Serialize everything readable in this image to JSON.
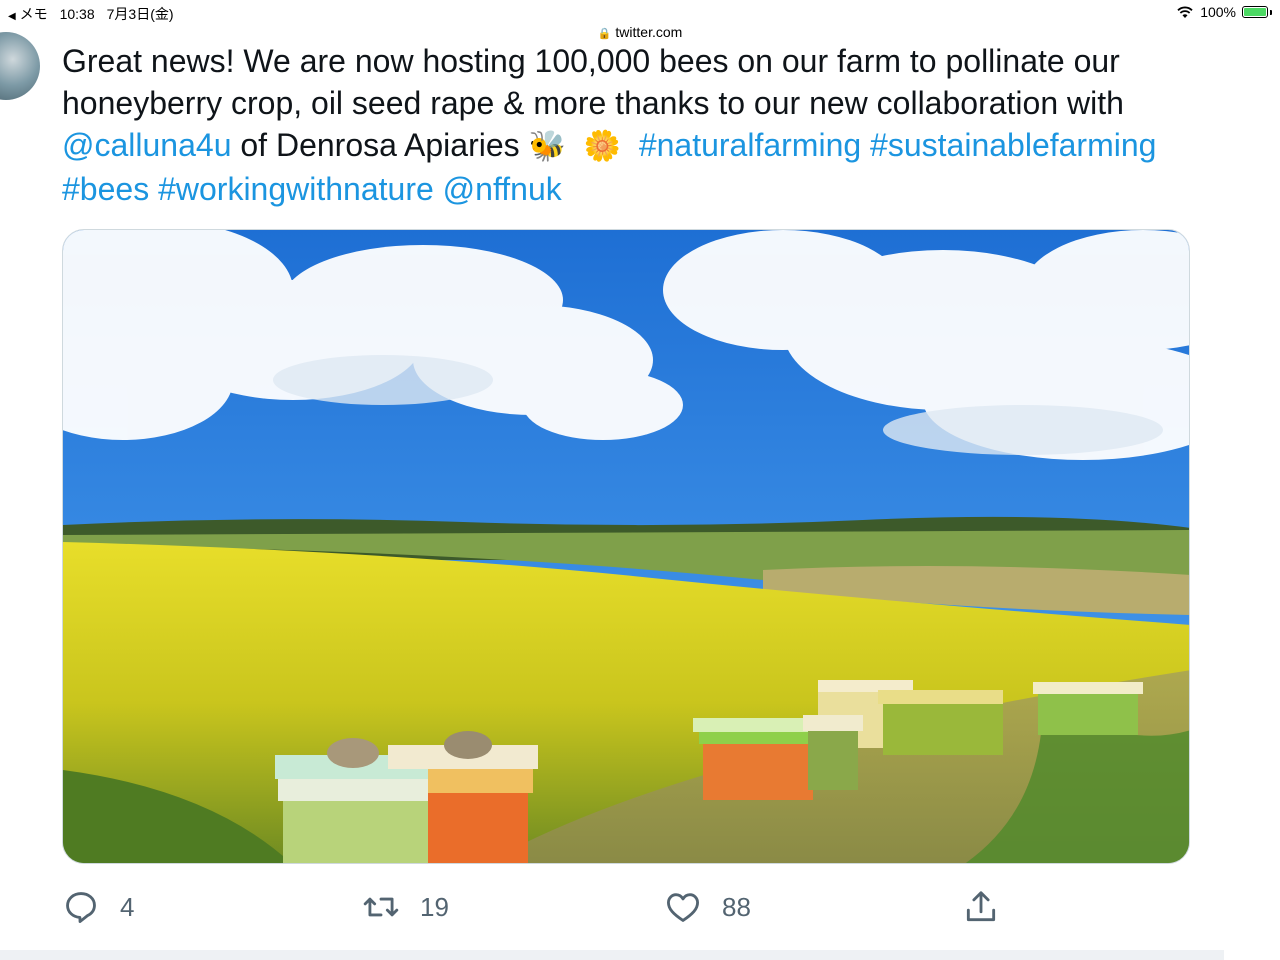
{
  "status_bar": {
    "back_app": "メモ",
    "time": "10:38",
    "date": "7月3日(金)",
    "battery_percent": "100%",
    "battery_level": 1.0
  },
  "browser": {
    "url": "twitter.com"
  },
  "tweet": {
    "text_part1": "Great news! We are now hosting 100,000 bees on our farm to pollinate our honeyberry crop, oil seed rape & more thanks to our new collaboration with ",
    "mention1": "@calluna4u",
    "text_part2": " of Denrosa Apiaries ",
    "emoji1": "🐝",
    "emoji2": "🌼",
    "hashtag1": "#naturalfarming",
    "hashtag2": "#sustainablefarming",
    "hashtag3": "#bees",
    "hashtag4": "#workingwithnature",
    "mention2": "@nffnuk",
    "media_alt": "Beehives in a yellow oilseed rape field under a blue sky"
  },
  "actions": {
    "reply_count": "4",
    "retweet_count": "19",
    "like_count": "88"
  },
  "colors": {
    "link": "#1b95e0",
    "icon": "#536471"
  },
  "icons": [
    "wifi-icon",
    "battery-icon",
    "lock-icon",
    "reply-icon",
    "retweet-icon",
    "like-icon",
    "share-icon"
  ]
}
